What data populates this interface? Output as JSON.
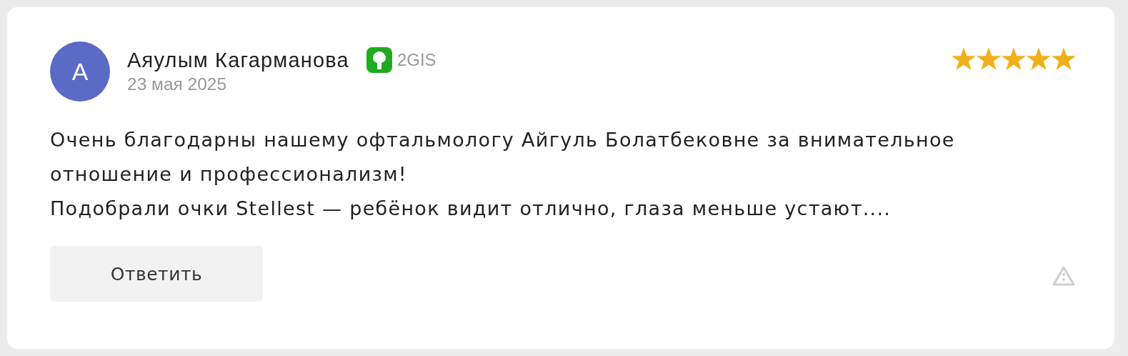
{
  "review": {
    "avatar_letter": "А",
    "author": "Аяулым Кагарманова",
    "source": "2GIS",
    "date": "23 мая 2025",
    "stars": 5,
    "text_lines": [
      "Очень благодарны нашему офтальмологу Айгуль Болатбековне за внимательное",
      "отношение и профессионализм!",
      "Подобрали очки Stellest — ребёнок видит отлично, глаза меньше устают...."
    ],
    "reply_button": "Ответить"
  }
}
